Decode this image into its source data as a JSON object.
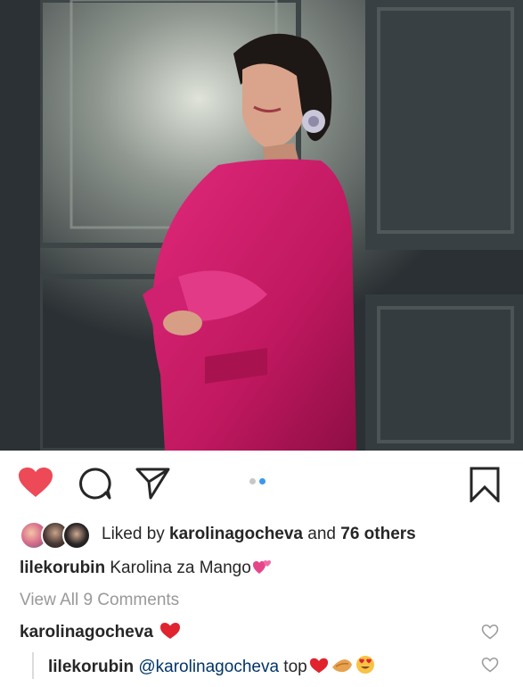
{
  "post": {
    "image_alt": "Woman in a pink coat posing in front of a dark paneled door",
    "carousel": {
      "total": 2,
      "active": 2
    },
    "liked": true
  },
  "likes": {
    "prefix": "Liked by ",
    "user": "karolinagocheva",
    "middle": " and ",
    "others": "76 others"
  },
  "caption": {
    "username": "lilekorubin",
    "text": " Karolina za Mango"
  },
  "view_all": "View All 9 Comments",
  "comments": [
    {
      "username": "karolinagocheva",
      "text": ""
    },
    {
      "username": "lilekorubin",
      "mention": "@karolinagocheva",
      "text": " top"
    }
  ],
  "icons": {
    "like": "heart-filled-icon",
    "comment": "comment-bubble-icon",
    "share": "paper-plane-icon",
    "save": "bookmark-icon",
    "comment_like": "heart-outline-icon"
  },
  "colors": {
    "like_red": "#ed4956",
    "link_blue": "#003569",
    "muted_gray": "#999999",
    "carousel_active": "#3897f0"
  }
}
